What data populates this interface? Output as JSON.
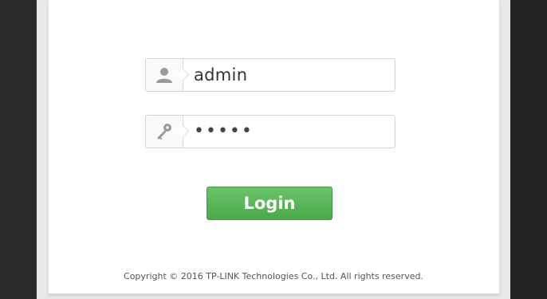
{
  "login_form": {
    "username_value": "admin",
    "password_mask": "•••••",
    "username_icon": "user-icon",
    "password_icon": "key-icon",
    "login_label": "Login"
  },
  "footer": {
    "copyright": "Copyright © 2016 TP-LINK Technologies Co., Ltd. All rights reserved."
  },
  "colors": {
    "login_button": "#5cb85c",
    "background": "#1e1e1e",
    "card": "#ffffff"
  }
}
